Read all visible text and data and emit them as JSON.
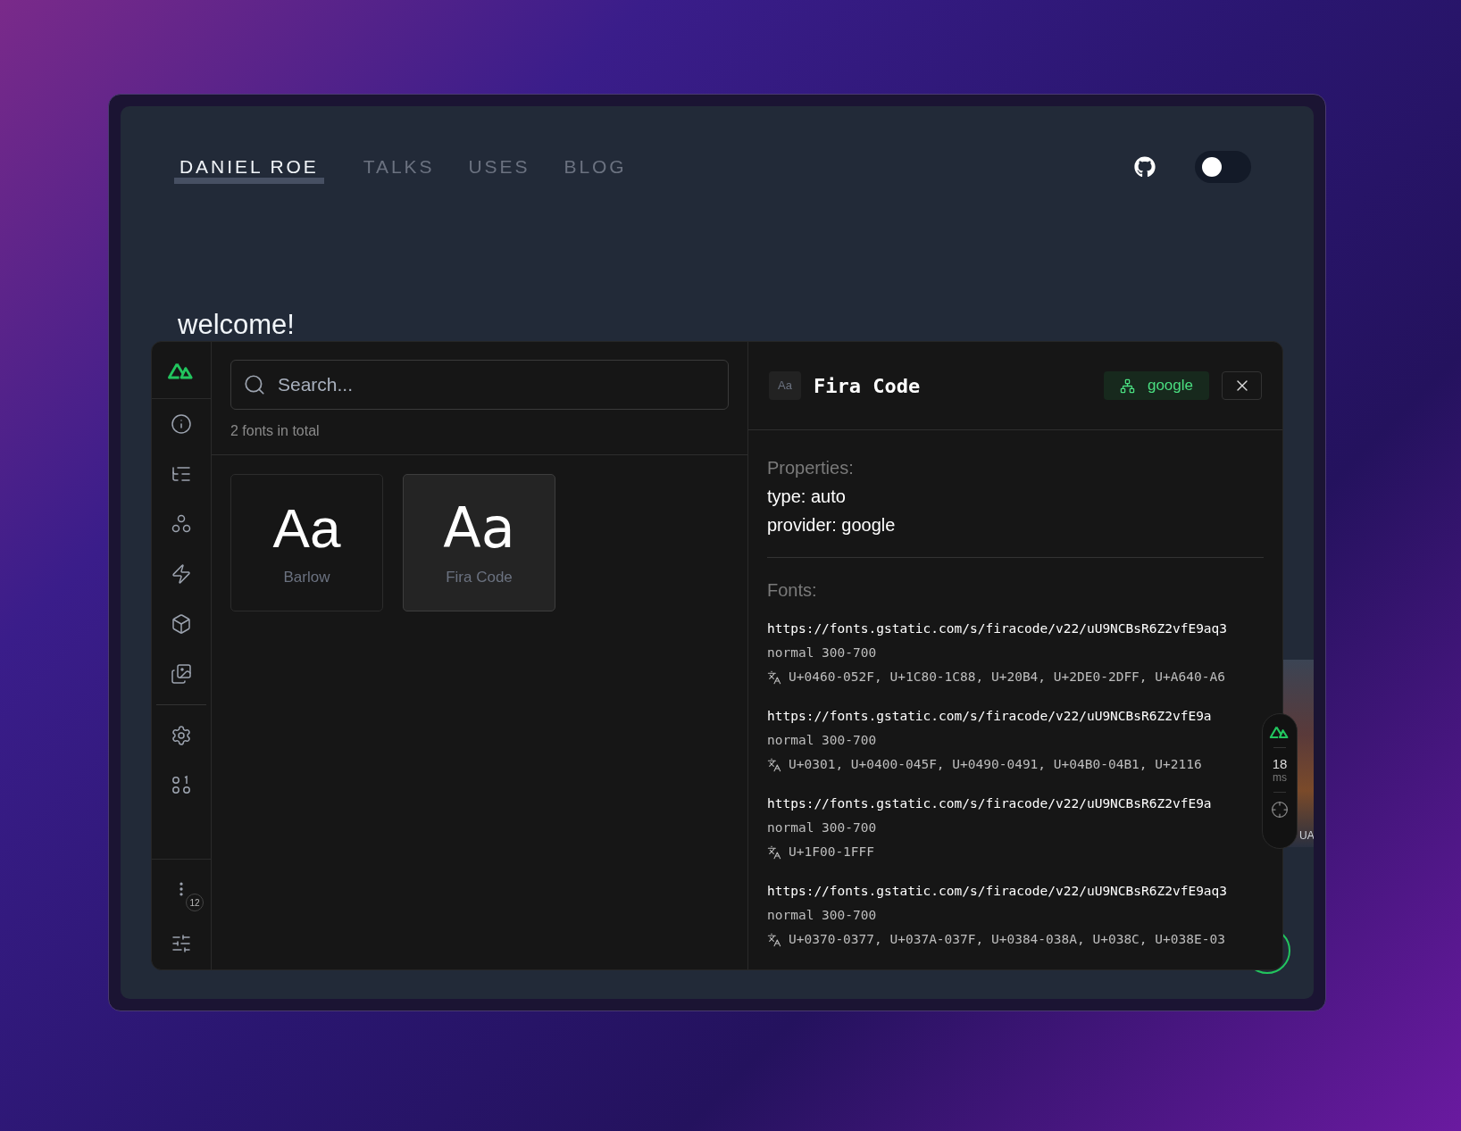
{
  "site": {
    "nav": [
      {
        "label": "DANIEL ROE",
        "selected": true
      },
      {
        "label": "TALKS",
        "selected": false
      },
      {
        "label": "USES",
        "selected": false
      },
      {
        "label": "BLOG",
        "selected": false
      }
    ],
    "theme_toggle": {
      "on": false
    },
    "heading": "welcome!"
  },
  "devtools": {
    "sidebar": {
      "badge": "12"
    },
    "search": {
      "placeholder": "Search..."
    },
    "count": "2 fonts in total",
    "fonts": [
      {
        "sample": "Aa",
        "name": "Barlow",
        "selected": false
      },
      {
        "sample": "Aa",
        "name": "Fira Code",
        "selected": true
      }
    ],
    "detail": {
      "icon_label": "Aa",
      "title": "Fira Code",
      "provider_badge": "google",
      "properties_label": "Properties:",
      "properties": [
        "type: auto",
        "provider: google"
      ],
      "fonts_label": "Fonts:",
      "sources": [
        {
          "url": "https://fonts.gstatic.com/s/firacode/v22/uU9NCBsR6Z2vfE9aq3",
          "style": "normal 300-700",
          "ranges": "U+0460-052F, U+1C80-1C88, U+20B4, U+2DE0-2DFF, U+A640-A6"
        },
        {
          "url": "https://fonts.gstatic.com/s/firacode/v22/uU9NCBsR6Z2vfE9a",
          "style": "normal 300-700",
          "ranges": "U+0301, U+0400-045F, U+0490-0491, U+04B0-04B1, U+2116"
        },
        {
          "url": "https://fonts.gstatic.com/s/firacode/v22/uU9NCBsR6Z2vfE9a",
          "style": "normal 300-700",
          "ranges": "U+1F00-1FFF"
        },
        {
          "url": "https://fonts.gstatic.com/s/firacode/v22/uU9NCBsR6Z2vfE9aq3",
          "style": "normal 300-700",
          "ranges": "U+0370-0377, U+037A-037F, U+0384-038A, U+038C, U+038E-03"
        }
      ]
    }
  },
  "perf_widget": {
    "value": "18",
    "unit": "ms"
  },
  "background_fragment": "UA"
}
